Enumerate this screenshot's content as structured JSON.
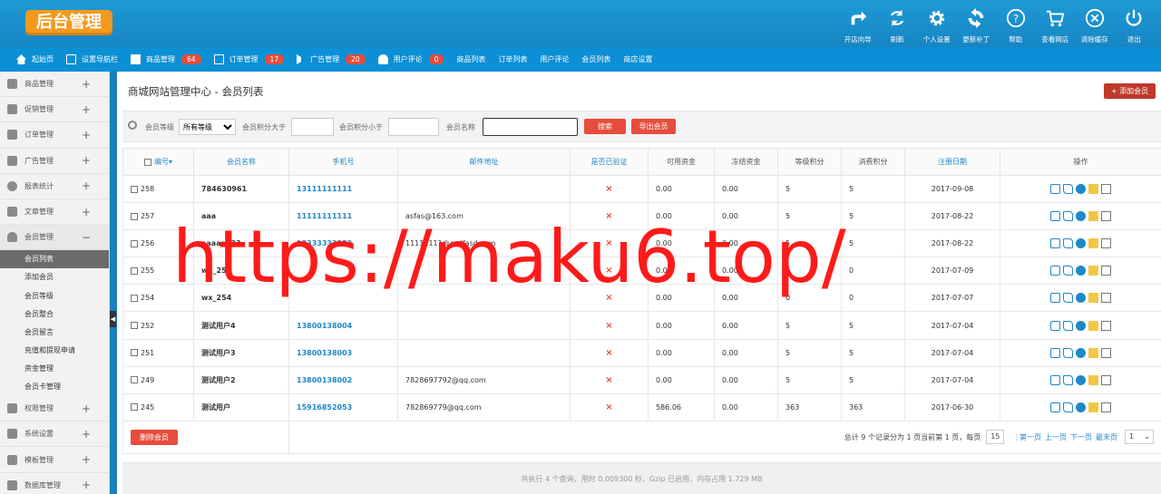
{
  "header": {
    "logo": "后台管理",
    "buttons": [
      {
        "label": "开店向导",
        "icon": "share-arrow-icon"
      },
      {
        "label": "刷新",
        "icon": "refresh-icon"
      },
      {
        "label": "个人设置",
        "icon": "gear-icon"
      },
      {
        "label": "更新补丁",
        "icon": "sync-icon"
      },
      {
        "label": "帮助",
        "icon": "help-icon"
      },
      {
        "label": "查看网店",
        "icon": "cart-icon"
      },
      {
        "label": "清除缓存",
        "icon": "close-circle-icon"
      },
      {
        "label": "退出",
        "icon": "power-icon"
      }
    ]
  },
  "nav": {
    "items": [
      {
        "label": "起始页",
        "badge": null
      },
      {
        "label": "设置导航栏",
        "badge": null
      },
      {
        "label": "商品管理",
        "badge": "64"
      },
      {
        "label": "订单管理",
        "badge": "17"
      },
      {
        "label": "广告管理",
        "badge": "20"
      },
      {
        "label": "用户评论",
        "badge": "0"
      },
      {
        "label": "商品列表",
        "badge": null
      },
      {
        "label": "订单列表",
        "badge": null
      },
      {
        "label": "用户评论",
        "badge": null
      },
      {
        "label": "会员列表",
        "badge": null
      },
      {
        "label": "商店设置",
        "badge": null
      }
    ]
  },
  "sidebar": {
    "groups_top": [
      "商品管理",
      "促销管理",
      "订单管理",
      "广告管理",
      "报表统计",
      "文章管理"
    ],
    "open_group": "会员管理",
    "sub_items": [
      "会员列表",
      "添加会员",
      "会员等级",
      "会员整合",
      "会员留言",
      "充值和提现申请",
      "资金管理",
      "会员卡管理"
    ],
    "groups_bottom": [
      "权限管理",
      "系统设置",
      "模板管理",
      "数据库管理"
    ]
  },
  "main": {
    "title": "商城网站管理中心 - 会员列表",
    "add_button": "+ 添加会员",
    "search": {
      "level_label": "会员等级",
      "level_value": "所有等级",
      "points_gt_label": "会员积分大于",
      "points_lt_label": "会员积分小于",
      "name_label": "会员名称",
      "search_button": "搜索",
      "export_button": "导出会员"
    },
    "columns": [
      "编号",
      "会员名称",
      "手机号",
      "邮件地址",
      "是否已验证",
      "可用资金",
      "冻结资金",
      "等级积分",
      "消费积分",
      "注册日期",
      "操作"
    ],
    "rows": [
      {
        "id": "258",
        "name": "784630961",
        "phone": "13111111111",
        "email": "",
        "verified": "×",
        "funds": "0.00",
        "frozen": "0.00",
        "rank_points": "5",
        "pay_points": "5",
        "reg_date": "2017-09-08"
      },
      {
        "id": "257",
        "name": "aaa",
        "phone": "11111111111",
        "email": "asfas@163.com",
        "verified": "×",
        "funds": "0.00",
        "frozen": "0.00",
        "rank_points": "5",
        "pay_points": "5",
        "reg_date": "2017-08-22"
      },
      {
        "id": "256",
        "name": "aaaaaa33",
        "phone": "13333333333",
        "email": "11111111@asdfasd.com",
        "verified": "×",
        "funds": "0.00",
        "frozen": "0.00",
        "rank_points": "5",
        "pay_points": "5",
        "reg_date": "2017-08-22"
      },
      {
        "id": "255",
        "name": "wx_255",
        "phone": "",
        "email": "",
        "verified": "×",
        "funds": "0.00",
        "frozen": "0.00",
        "rank_points": "0",
        "pay_points": "0",
        "reg_date": "2017-07-09"
      },
      {
        "id": "254",
        "name": "wx_254",
        "phone": "",
        "email": "",
        "verified": "×",
        "funds": "0.00",
        "frozen": "0.00",
        "rank_points": "0",
        "pay_points": "0",
        "reg_date": "2017-07-07"
      },
      {
        "id": "252",
        "name": "测试用户4",
        "phone": "13800138004",
        "email": "",
        "verified": "×",
        "funds": "0.00",
        "frozen": "0.00",
        "rank_points": "5",
        "pay_points": "5",
        "reg_date": "2017-07-04"
      },
      {
        "id": "251",
        "name": "测试用户3",
        "phone": "13800138003",
        "email": "",
        "verified": "×",
        "funds": "0.00",
        "frozen": "0.00",
        "rank_points": "5",
        "pay_points": "5",
        "reg_date": "2017-07-04"
      },
      {
        "id": "249",
        "name": "测试用户2",
        "phone": "13800138002",
        "email": "7828697792@qq.com",
        "verified": "×",
        "funds": "0.00",
        "frozen": "0.00",
        "rank_points": "5",
        "pay_points": "5",
        "reg_date": "2017-07-04"
      },
      {
        "id": "245",
        "name": "测试用户",
        "phone": "15916852053",
        "email": "782869779@qq.com",
        "verified": "×",
        "funds": "586.06",
        "frozen": "0.00",
        "rank_points": "363",
        "pay_points": "363",
        "reg_date": "2017-06-30"
      }
    ],
    "delete_button": "删除会员",
    "pager": {
      "summary": "总计 9 个记录分为 1 页当前第 1 页，每页",
      "per_page": "15",
      "first": "第一页",
      "prev": "上一页",
      "next": "下一页",
      "last": "最末页",
      "page_select": "1"
    },
    "status_line": "共执行 4 个查询，用时 0.009300 秒，Gzip 已启用，内存占用 1.729 MB"
  },
  "watermark": "https://maku6.top/",
  "colors": {
    "header": "#1685c4",
    "nav": "#0c8fd5",
    "accent": "#e74c3c",
    "logo": "#f39a1e",
    "link": "#1e88c8"
  }
}
